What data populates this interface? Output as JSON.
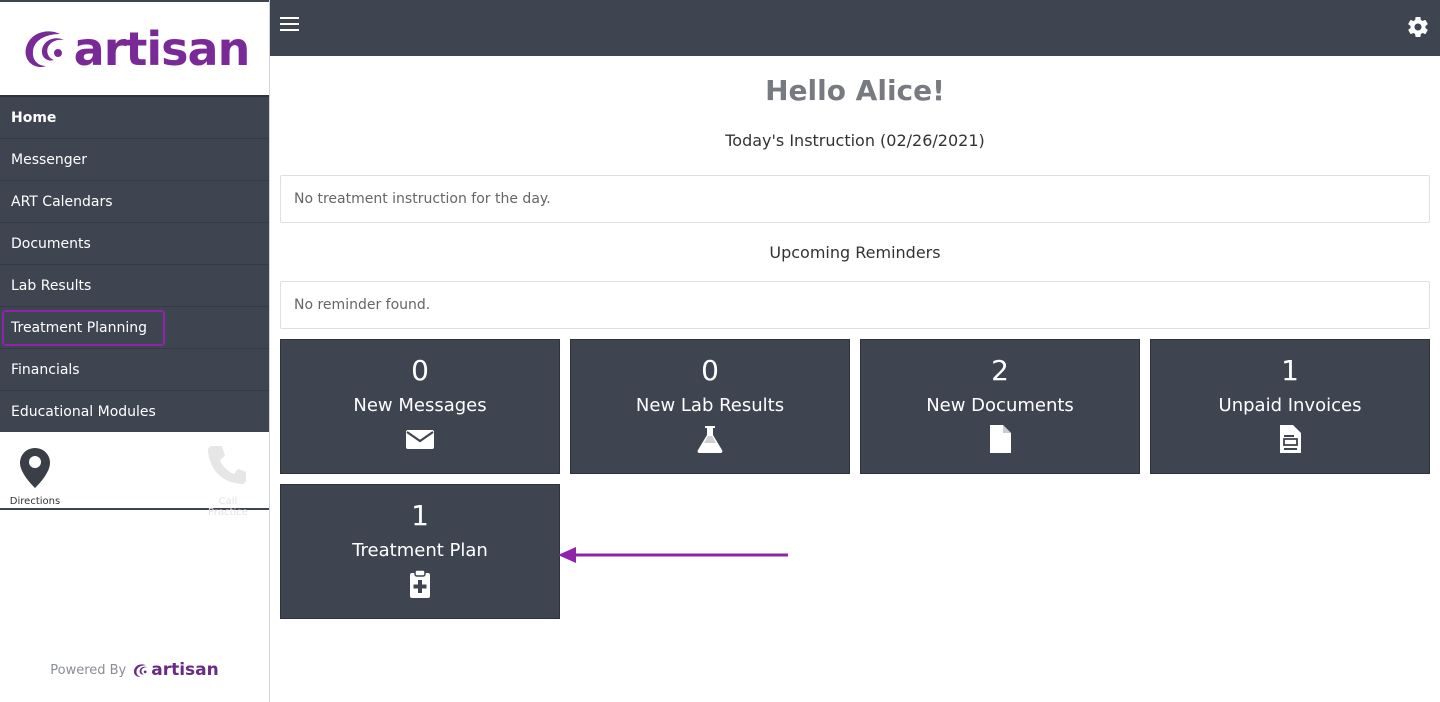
{
  "brand": {
    "name": "artisan",
    "color": "#7a2a96"
  },
  "sidebar": {
    "items": [
      {
        "label": "Home"
      },
      {
        "label": "Messenger"
      },
      {
        "label": "ART Calendars"
      },
      {
        "label": "Documents"
      },
      {
        "label": "Lab Results"
      },
      {
        "label": "Treatment Planning"
      },
      {
        "label": "Financials"
      },
      {
        "label": "Educational Modules"
      }
    ],
    "active": "Home",
    "highlighted": "Treatment Planning",
    "quick": {
      "directions": "Directions",
      "call": "Call Practice"
    },
    "powered_by": "Powered By",
    "powered_brand": "artisan"
  },
  "header": {
    "menu_icon": "hamburger-icon",
    "settings_icon": "gear-icon"
  },
  "main": {
    "greeting": "Hello Alice!",
    "instruction_title": "Today's Instruction (02/26/2021)",
    "instruction_text": "No treatment instruction for the day.",
    "reminders_title": "Upcoming Reminders",
    "reminders_text": "No reminder found.",
    "tiles": [
      {
        "count": "0",
        "label": "New Messages",
        "icon": "envelope-icon"
      },
      {
        "count": "0",
        "label": "New Lab Results",
        "icon": "flask-icon"
      },
      {
        "count": "2",
        "label": "New Documents",
        "icon": "document-icon"
      },
      {
        "count": "1",
        "label": "Unpaid Invoices",
        "icon": "invoice-icon"
      },
      {
        "count": "1",
        "label": "Treatment Plan",
        "icon": "clipboard-plus-icon"
      }
    ]
  },
  "colors": {
    "dark": "#3f4550",
    "accent": "#8e24aa",
    "text_muted": "#777a80"
  }
}
